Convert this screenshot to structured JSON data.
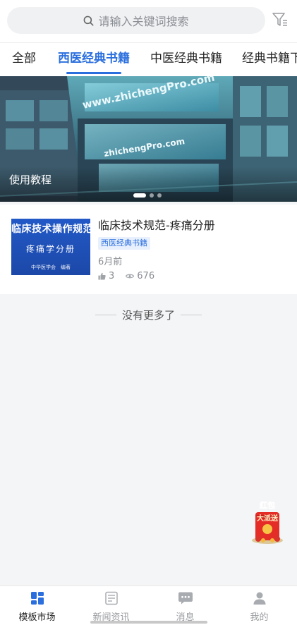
{
  "search": {
    "placeholder": "请输入关键词搜索"
  },
  "tabs": [
    {
      "label": "全部"
    },
    {
      "label": "西医经典书籍",
      "active": true
    },
    {
      "label": "中医经典书籍"
    },
    {
      "label": "经典书籍下"
    }
  ],
  "banner": {
    "caption": "使用教程",
    "watermark_1": "www.zhichengPro.com",
    "watermark_2": "zhichengPro.com",
    "slide_count": 3,
    "active_slide": 1
  },
  "card": {
    "thumbnail": {
      "title": "临床技术操作规范",
      "subtitle": "疼痛学分册",
      "footer": "中华医学会　编著"
    },
    "title": "临床技术规范-疼痛分册",
    "tag": "西医经典书籍",
    "time": "6月前",
    "likes": "3",
    "views": "676"
  },
  "end_text": "没有更多了",
  "red_packet": {
    "line1": "红包",
    "line2": "大派送"
  },
  "bottom_nav": [
    {
      "label": "模板市场",
      "icon": "grid-icon",
      "active": true
    },
    {
      "label": "新闻资讯",
      "icon": "news-icon"
    },
    {
      "label": "消息",
      "icon": "message-icon"
    },
    {
      "label": "我的",
      "icon": "user-icon"
    }
  ],
  "colors": {
    "accent": "#2b6fde",
    "muted": "#8a8d93",
    "background": "#f4f5f7"
  }
}
